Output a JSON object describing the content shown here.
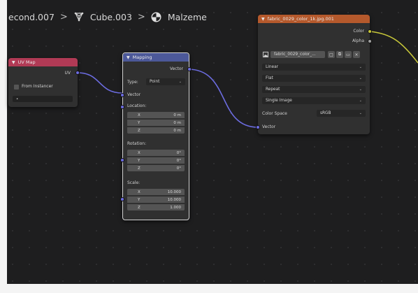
{
  "breadcrumb": {
    "items": [
      "econd.007",
      "Cube.003",
      "Malzeme"
    ],
    "separator": ">",
    "icons": [
      "mesh-icon",
      "material-icon"
    ]
  },
  "uv_map_node": {
    "title": "UV Map",
    "output_label": "UV",
    "from_instancer_label": "From Instancer",
    "uv_field_value": "•",
    "header_color": "#b13a55"
  },
  "mapping_node": {
    "title": "Mapping",
    "output_label": "Vector",
    "type_label": "Type:",
    "type_value": "Point",
    "vector_label": "Vector",
    "location_label": "Location:",
    "location": [
      {
        "axis": "X",
        "value": "0 m"
      },
      {
        "axis": "Y",
        "value": "0 m"
      },
      {
        "axis": "Z",
        "value": "0 m"
      }
    ],
    "rotation_label": "Rotation:",
    "rotation": [
      {
        "axis": "X",
        "value": "0°"
      },
      {
        "axis": "Y",
        "value": "0°"
      },
      {
        "axis": "Z",
        "value": "0°"
      }
    ],
    "scale_label": "Scale:",
    "scale": [
      {
        "axis": "X",
        "value": "10.000"
      },
      {
        "axis": "Y",
        "value": "10.000"
      },
      {
        "axis": "Z",
        "value": "1.000"
      }
    ],
    "header_color": "#4c5899"
  },
  "image_texture_node": {
    "title": "fabric_0029_color_1k.jpg.001",
    "outputs": [
      "Color",
      "Alpha"
    ],
    "image_name": "fabric_0029_color_...",
    "interpolation": "Linear",
    "projection": "Flat",
    "extension": "Repeat",
    "source": "Single Image",
    "color_space_label": "Color Space",
    "color_space_value": "sRGB",
    "input_label": "Vector",
    "header_color": "#b5592c"
  },
  "links": {
    "vector_color": "#6c6ce0",
    "color_color": "#c8c83a"
  }
}
